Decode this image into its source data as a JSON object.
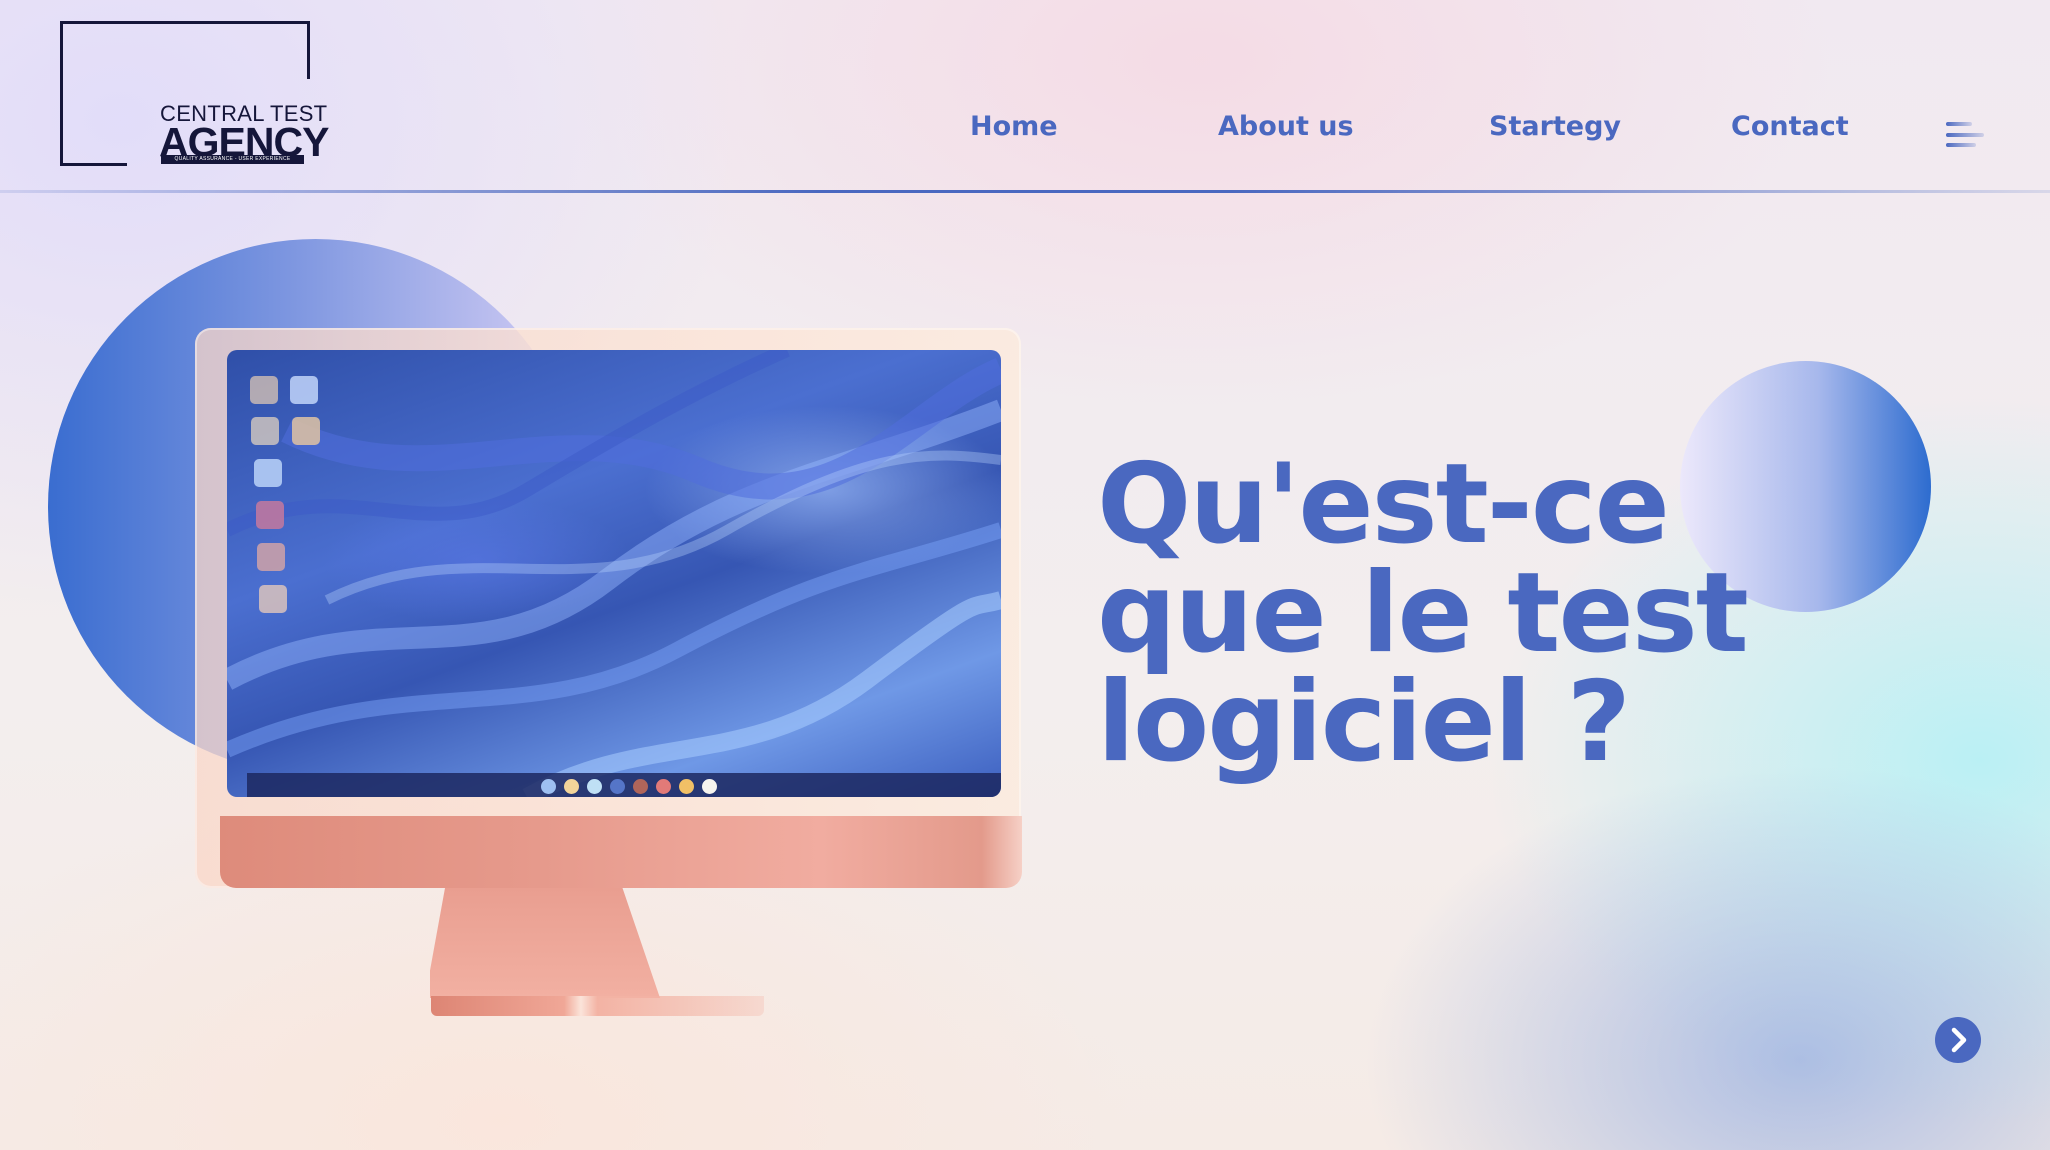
{
  "logo": {
    "line1": "CENTRAL TEST",
    "line2": "AGENCY",
    "tagline": "QUALITY ASSURANCE - USER EXPERIENCE"
  },
  "nav": {
    "items": [
      {
        "label": "Home"
      },
      {
        "label": "About us"
      },
      {
        "label": "Startegy"
      },
      {
        "label": "Contact"
      }
    ],
    "menu_icon": "hamburger-menu-icon"
  },
  "hero": {
    "title_lines": [
      "Qu'est-ce",
      "que le test",
      "logiciel ?"
    ]
  },
  "monitor": {
    "desktop_icons": 6,
    "dock_icons": 8
  },
  "next_icon": "chevron-right-icon",
  "colors": {
    "accent": "#4a68c0",
    "dark": "#15163a",
    "monitor_body": "#e69a8c",
    "screen_blue": "#3a5cbf"
  }
}
